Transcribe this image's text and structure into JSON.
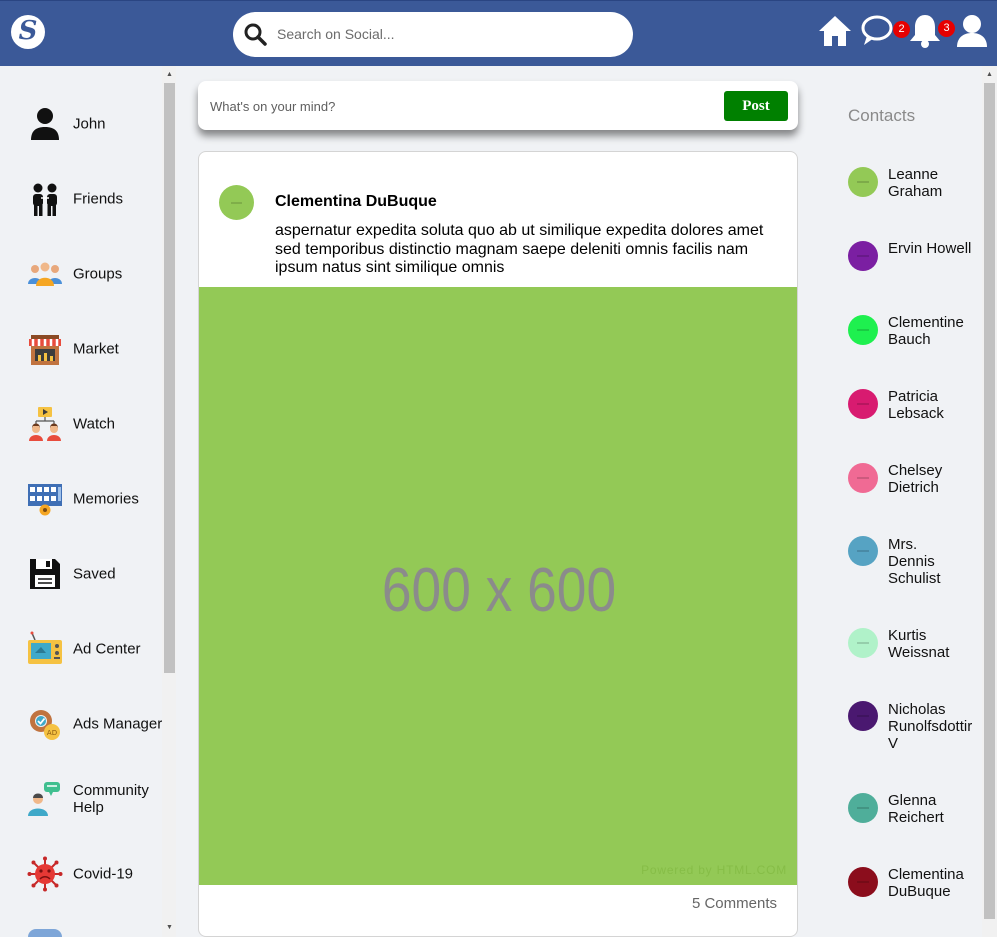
{
  "app": {
    "logo_letter": "S"
  },
  "search": {
    "placeholder": "Search on Social..."
  },
  "topbar": {
    "icons": [
      "home-icon",
      "messages-icon",
      "notifications-icon",
      "profile-icon"
    ],
    "messages_badge": "2",
    "notifications_badge": "3"
  },
  "sidebar": {
    "items": [
      {
        "label": "John",
        "icon": "user-icon"
      },
      {
        "label": "Friends",
        "icon": "friends-icon"
      },
      {
        "label": "Groups",
        "icon": "groups-icon"
      },
      {
        "label": "Market",
        "icon": "market-icon"
      },
      {
        "label": "Watch",
        "icon": "watch-icon"
      },
      {
        "label": "Memories",
        "icon": "memories-icon"
      },
      {
        "label": "Saved",
        "icon": "saved-icon"
      },
      {
        "label": "Ad Center",
        "icon": "ad-center-icon"
      },
      {
        "label": "Ads Manager",
        "icon": "ads-manager-icon"
      },
      {
        "label": "Community Help",
        "icon": "community-help-icon"
      },
      {
        "label": "Covid-19",
        "icon": "covid-icon"
      }
    ]
  },
  "composer": {
    "placeholder": "What's on your mind?",
    "post_label": "Post"
  },
  "post": {
    "author": "Clementina DuBuque",
    "body": "aspernatur expedita soluta quo ab ut similique expedita dolores amet sed temporibus distinctio magnam saepe deleniti omnis facilis nam ipsum natus sint similique omnis",
    "image_text": "600 x 600",
    "image_credit": "Powered by HTML.COM",
    "comments": "5 Comments",
    "avatar_color": "#93c956",
    "image_color": "#93c956"
  },
  "contacts": {
    "title": "Contacts",
    "items": [
      {
        "name": "Leanne Graham",
        "color": "#93c956"
      },
      {
        "name": "Ervin Howell",
        "color": "#7b1fa2"
      },
      {
        "name": "Clementine Bauch",
        "color": "#1ef04f"
      },
      {
        "name": "Patricia Lebsack",
        "color": "#d81b70"
      },
      {
        "name": "Chelsey Dietrich",
        "color": "#f06a94"
      },
      {
        "name": "Mrs. Dennis Schulist",
        "color": "#56a3c3"
      },
      {
        "name": "Kurtis Weissnat",
        "color": "#b0f2c9"
      },
      {
        "name": "Nicholas Runolfsdottir V",
        "color": "#4a1870"
      },
      {
        "name": "Glenna Reichert",
        "color": "#4fae9a"
      },
      {
        "name": "Clementina DuBuque",
        "color": "#8b0d1c"
      }
    ]
  }
}
